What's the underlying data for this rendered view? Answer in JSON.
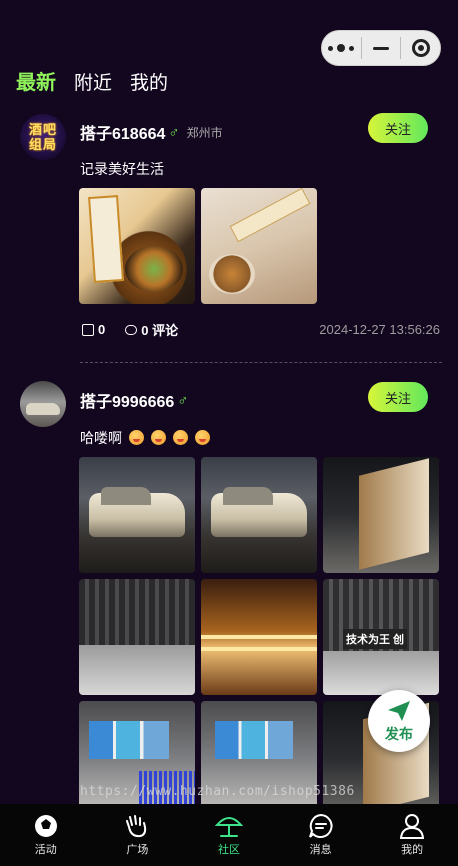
{
  "capsule": {
    "more_icon": "more-dots-icon",
    "minimize_icon": "minimize-icon",
    "close_icon": "target-close-icon"
  },
  "tabs": [
    {
      "label": "最新",
      "active": true
    },
    {
      "label": "附近",
      "active": false
    },
    {
      "label": "我的",
      "active": false
    }
  ],
  "posts": [
    {
      "avatar_text_1": "酒吧",
      "avatar_text_2": "组局",
      "username": "搭子618664",
      "gender": "♂",
      "city": "郑州市",
      "follow_label": "关注",
      "content": "记录美好生活",
      "likes": "0",
      "comments": "0 评论",
      "time": "2024-12-27 13:56:26"
    },
    {
      "username": "搭子9996666",
      "gender": "♂",
      "follow_label": "关注",
      "content": "哈喽啊"
    }
  ],
  "watermark": "https://www.huzhan.com/ishop51386",
  "fab": {
    "label": "发布",
    "icon": "send-arrow-icon"
  },
  "tabbar": [
    {
      "label": "活动",
      "icon": "football-icon",
      "active": false
    },
    {
      "label": "广场",
      "icon": "wave-hand-icon",
      "active": false
    },
    {
      "label": "社区",
      "icon": "umbrella-icon",
      "active": true
    },
    {
      "label": "消息",
      "icon": "message-icon",
      "active": false
    },
    {
      "label": "我的",
      "icon": "user-icon",
      "active": false
    }
  ],
  "colors": {
    "accent": "#8ff25a",
    "active_tab": "#3ee28a",
    "background": "#13061f"
  }
}
